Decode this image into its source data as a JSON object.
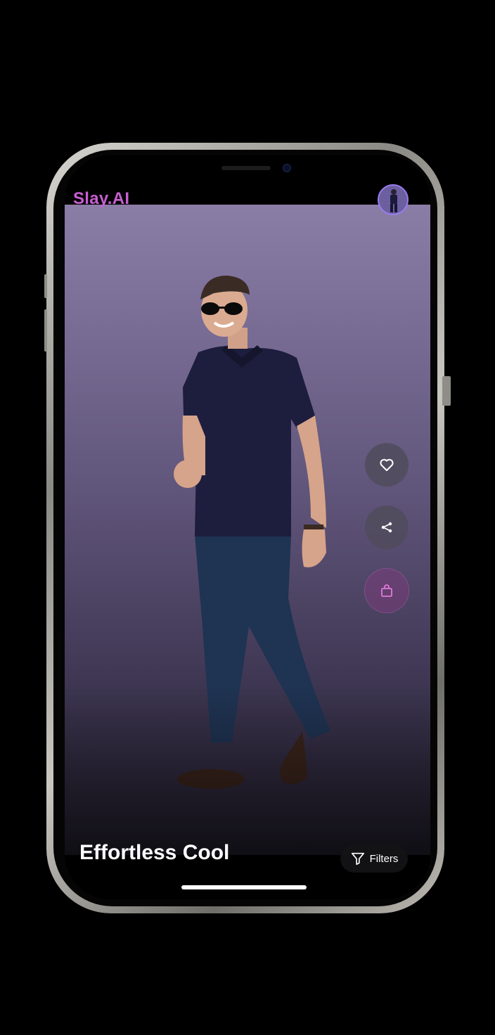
{
  "app": {
    "brand": "Slay.AI"
  },
  "outfit": {
    "title": "Effortless Cool"
  },
  "controls": {
    "filters_label": "Filters"
  },
  "actions": [
    {
      "icon": "heart-icon"
    },
    {
      "icon": "share-icon"
    },
    {
      "icon": "shopping-bag-icon"
    }
  ],
  "colors": {
    "brand": "#c85ed3",
    "background_top": "#8a7da6",
    "background_bottom": "#24202e"
  }
}
